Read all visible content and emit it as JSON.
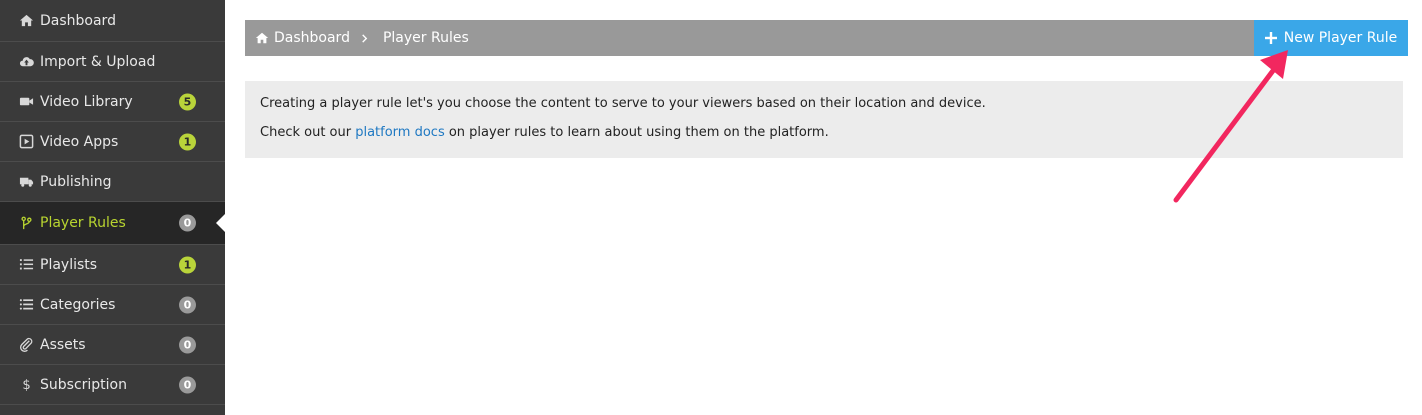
{
  "sidebar": {
    "items": [
      {
        "label": "Dashboard",
        "icon": "home-icon"
      },
      {
        "label": "Import & Upload",
        "icon": "cloud-upload-icon"
      },
      {
        "label": "Video Library",
        "icon": "video-camera-icon",
        "badge": "5"
      },
      {
        "label": "Video Apps",
        "icon": "play-square-icon",
        "badge": "1"
      },
      {
        "label": "Publishing",
        "icon": "truck-icon"
      },
      {
        "label": "Player Rules",
        "icon": "branch-icon",
        "badge": "0",
        "active": true
      },
      {
        "label": "Playlists",
        "icon": "list-ordered-icon",
        "badge": "1"
      },
      {
        "label": "Categories",
        "icon": "list-icon",
        "badge": "0"
      },
      {
        "label": "Assets",
        "icon": "paperclip-icon",
        "badge": "0"
      },
      {
        "label": "Subscription",
        "icon": "dollar-icon",
        "badge": "0"
      }
    ]
  },
  "breadcrumb": {
    "home": "Dashboard",
    "current": "Player Rules"
  },
  "toolbar": {
    "new_label": "New Player Rule"
  },
  "info": {
    "line1": "Creating a player rule let's you choose the content to serve to your viewers based on their location and device.",
    "line2_prefix": "Check out our ",
    "line2_link": "platform docs",
    "line2_suffix": " on player rules to learn about using them on the platform."
  },
  "colors": {
    "sidebar_bg": "#3a3a3a",
    "active_text": "#b8d430",
    "badge_green": "#b9d43a",
    "button_blue": "#3aa7e8",
    "annotation_arrow": "#f2275f"
  }
}
